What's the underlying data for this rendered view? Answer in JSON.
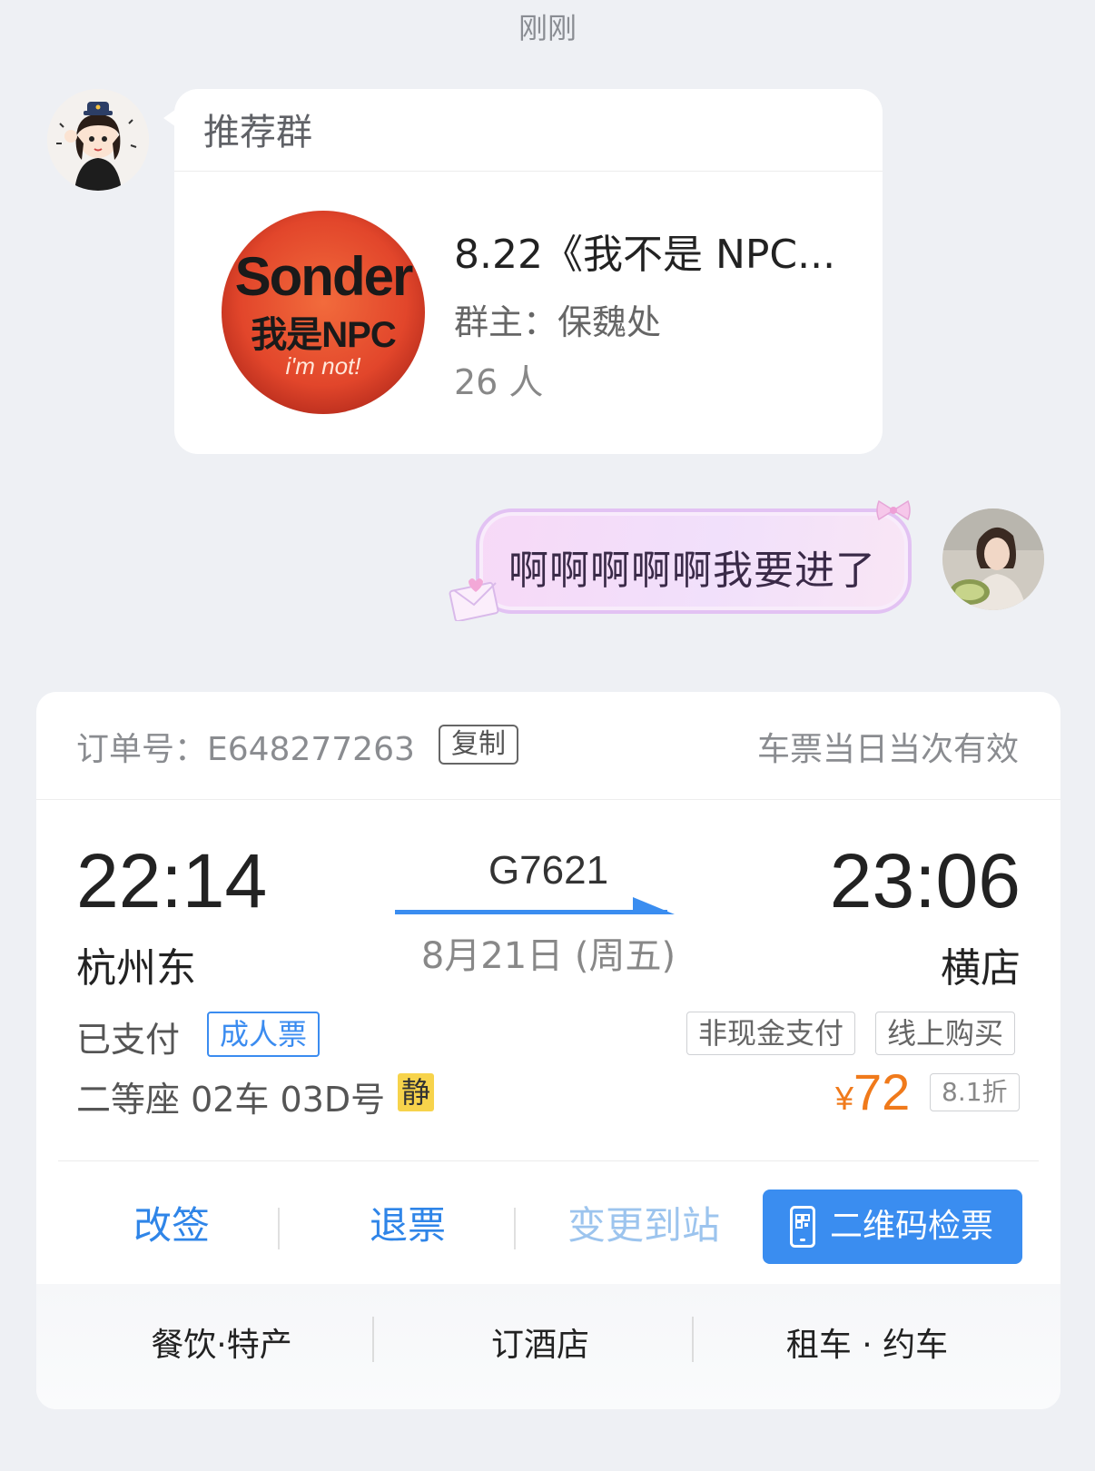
{
  "timestamp": "刚刚",
  "group_card": {
    "header": "推荐群",
    "logo": {
      "line1": "Sonder",
      "line2": "我是NPC",
      "line3": "i'm not!"
    },
    "name": "8.22《我不是 NPC...",
    "owner": "群主：保魏处",
    "member_count": "26 人"
  },
  "reply_bubble": {
    "text": "啊啊啊啊啊我要进了"
  },
  "ticket": {
    "order_label": "订单号：E648277263",
    "copy_label": "复制",
    "validity": "车票当日当次有效",
    "departure_time": "22:14",
    "departure_station": "杭州东",
    "train_number": "G7621",
    "date": "8月21日 (周五)",
    "arrival_time": "23:06",
    "arrival_station": "横店",
    "payment_status": "已支付",
    "ticket_type": "成人票",
    "tags": [
      "非现金支付",
      "线上购买"
    ],
    "seat": "二等座 02车 03D号",
    "quiet_tag": "静",
    "price_currency": "¥",
    "price": "72",
    "discount": "8.1折",
    "actions": {
      "change": "改签",
      "refund": "退票",
      "change_station": "变更到站",
      "qr_check": "二维码检票"
    },
    "services": {
      "food": "餐饮·特产",
      "hotel": "订酒店",
      "car": "租车 · 约车"
    }
  },
  "colors": {
    "accent_blue": "#3a8df0",
    "price_orange": "#f07a1b",
    "quiet_yellow": "#f7d34b",
    "bubble_purple": "#e2c2f3"
  }
}
